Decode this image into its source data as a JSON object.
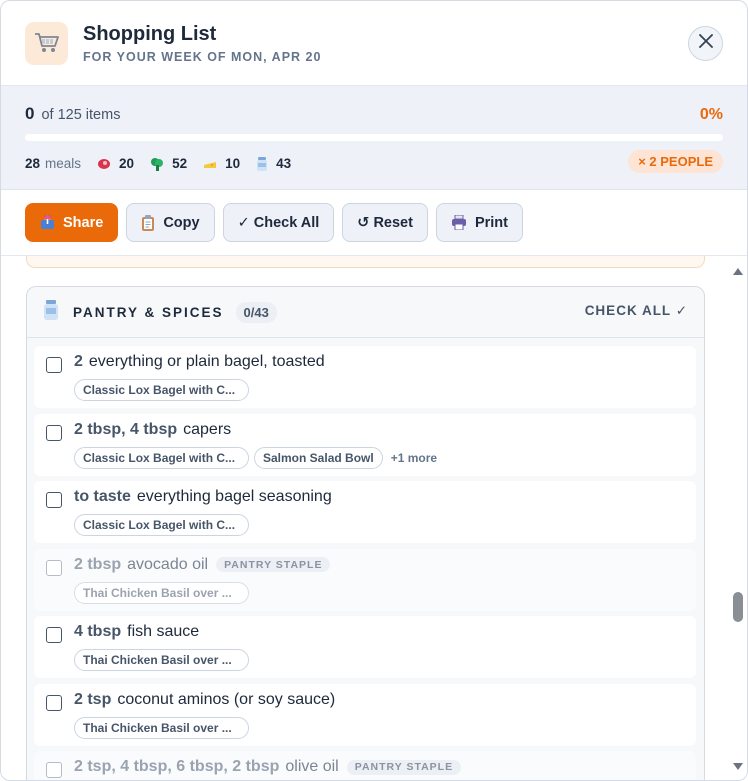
{
  "header": {
    "title": "Shopping List",
    "subtitle": "FOR YOUR WEEK OF MON, APR 20"
  },
  "progress": {
    "checked": "0",
    "of_text": "of 125 items",
    "percent_text": "0%",
    "fraction": 0
  },
  "stats": {
    "meals_count": "28",
    "meals_label": "meals",
    "protein_count": "20",
    "produce_count": "52",
    "dairy_count": "10",
    "pantry_count": "43",
    "people": "× 2 PEOPLE"
  },
  "toolbar": {
    "share": "Share",
    "copy": "Copy",
    "check_all": "✓ Check All",
    "reset": "↺ Reset",
    "print": "Print"
  },
  "section": {
    "title": "PANTRY & SPICES",
    "count": "0/43",
    "check_all": "CHECK ALL ✓"
  },
  "items": [
    {
      "qty": "2",
      "name": "everything or plain bagel, toasted",
      "staple": false,
      "tags": [
        "Classic Lox Bagel with C..."
      ],
      "more": ""
    },
    {
      "qty": "2 tbsp, 4 tbsp",
      "name": "capers",
      "staple": false,
      "tags": [
        "Classic Lox Bagel with C...",
        "Salmon Salad Bowl"
      ],
      "more": "+1 more"
    },
    {
      "qty": "to taste",
      "name": "everything bagel seasoning",
      "staple": false,
      "tags": [
        "Classic Lox Bagel with C..."
      ],
      "more": ""
    },
    {
      "qty": "2 tbsp",
      "name": "avocado oil",
      "staple": true,
      "tags": [
        "Thai Chicken Basil over ..."
      ],
      "more": ""
    },
    {
      "qty": "4 tbsp",
      "name": "fish sauce",
      "staple": false,
      "tags": [
        "Thai Chicken Basil over ..."
      ],
      "more": ""
    },
    {
      "qty": "2 tsp",
      "name": "coconut aminos (or soy sauce)",
      "staple": false,
      "tags": [
        "Thai Chicken Basil over ..."
      ],
      "more": ""
    },
    {
      "qty": "2 tsp, 4 tbsp, 6 tbsp, 2 tbsp",
      "name": "olive oil",
      "staple": true,
      "tags": [],
      "more": ""
    }
  ],
  "staple_label": "PANTRY STAPLE",
  "colors": {
    "accent": "#ea6a0a",
    "text": "#1e293b",
    "muted": "#64748b",
    "progress_bg": "#eef1f8"
  }
}
